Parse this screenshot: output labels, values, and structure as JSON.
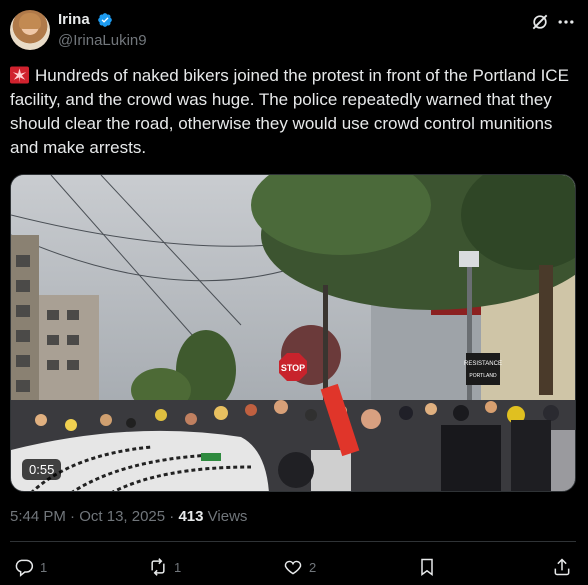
{
  "author": {
    "display_name": "Irina",
    "handle": "@IrinaLukin9",
    "verified": true,
    "avatar_icon": "profile-photo"
  },
  "header_icons": [
    "grok-icon",
    "more-icon"
  ],
  "tweet": {
    "emoji_icon": "police-light-siren",
    "text": "Hundreds of naked bikers joined the protest in front of the Portland ICE facility, and the crowd was huge. The police repeatedly warned that they should clear the road, otherwise they would use crowd control munitions and make arrests."
  },
  "media": {
    "type": "video",
    "duration": "0:55",
    "scene_signs": {
      "stop": "STOP",
      "resistance": "RESISTANCE",
      "resistance_sub": "PORTLAND"
    }
  },
  "meta": {
    "time": "5:44 PM",
    "separator": " · ",
    "date": "Oct 13, 2025",
    "views_count": "413",
    "views_label": " Views"
  },
  "actions": {
    "reply_count": "1",
    "retweet_count": "1",
    "like_count": "2"
  },
  "colors": {
    "background": "#000000",
    "text_primary": "#e7e9ea",
    "text_secondary": "#71767b",
    "verified_blue": "#1d9bf0",
    "divider": "#2f3336"
  }
}
